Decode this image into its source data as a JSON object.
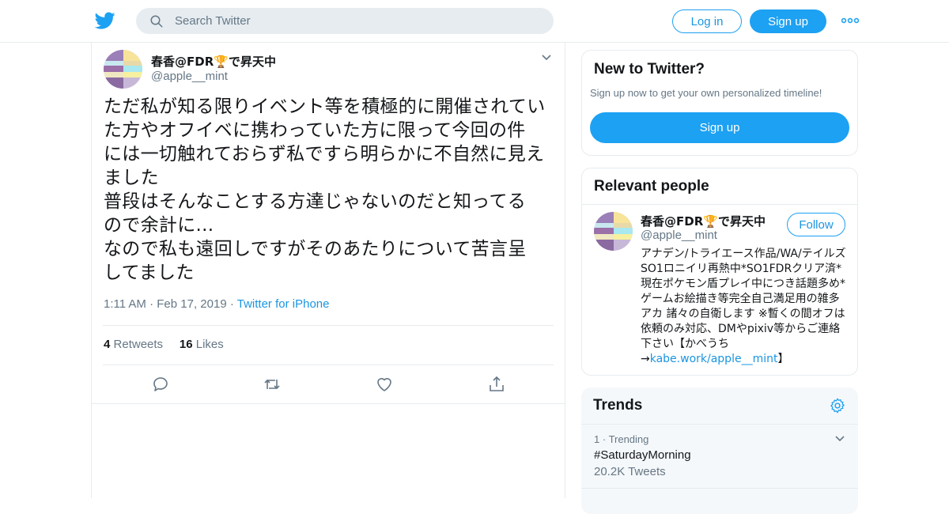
{
  "header": {
    "search_placeholder": "Search Twitter",
    "login_label": "Log in",
    "signup_label": "Sign up",
    "logo_icon": "twitter-bird-icon",
    "more_icon": "more-dots-icon"
  },
  "tweet": {
    "author_name": "春香@FDR",
    "author_name_suffix": "で昇天中",
    "handle": "@apple__mint",
    "text": "ただ私が知る限りイベント等を積極的に開催されてい\nた方やオフイベに携わっていた方に限って今回の件\nには一切触れておらず私ですら明らかに不自然に見え\nました\n普段はそんなことする方達じゃないのだと知ってる\nので余計に...\nなので私も遠回しですがそのあたりについて苦言呈\nしてました",
    "time": "1:11 AM",
    "date": "Feb 17, 2019",
    "source": "Twitter for iPhone",
    "retweets_count": "4",
    "retweets_label": "Retweets",
    "likes_count": "16",
    "likes_label": "Likes"
  },
  "sidebar": {
    "new_to_twitter": {
      "title": "New to Twitter?",
      "subtitle": "Sign up now to get your own personalized timeline!",
      "button": "Sign up"
    },
    "relevant_people": {
      "title": "Relevant people",
      "name": "春香@FDR",
      "name_suffix": "で昇天中",
      "handle": "@apple__mint",
      "follow_label": "Follow",
      "bio": "アナデン/トライエース作品/WA/テイルズ SO1ロニイリ再熱中*SO1FDRクリア済*現在ポケモン盾プレイ中につき話題多め*ゲームお絵描き等完全自己満足用の雑多アカ 諸々の自衛します ※暫くの間オフは依頼のみ対応、DMやpixiv等からご連絡下さい【かべうち→",
      "bio_link": "kabe.work/apple__mint",
      "bio_end": "】"
    },
    "trends": {
      "title": "Trends",
      "items": [
        {
          "rank": "1",
          "context": "Trending",
          "tag": "#SaturdayMorning",
          "count": "20.2K Tweets"
        }
      ]
    }
  },
  "colors": {
    "accent": "#1da1f2",
    "link": "#1b95e0",
    "muted": "#657786",
    "border": "#e6ecf0"
  }
}
